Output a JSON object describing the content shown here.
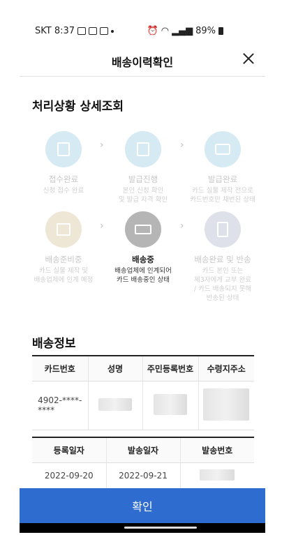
{
  "status_bar": {
    "carrier_time": "SKT 8:37",
    "battery": "89%"
  },
  "header": {
    "title": "배송이력확인"
  },
  "status_section": {
    "title": "처리상황 상세조회"
  },
  "steps": [
    {
      "label": "접수완료",
      "desc": "신청 접수 완료"
    },
    {
      "label": "발급진행",
      "desc": "본인 신청 확인\n및 발급 자격 확인"
    },
    {
      "label": "발급완료",
      "desc": "카드 실물 제작 전으로\n카드번호만 채번된 상태"
    },
    {
      "label": "배송준비중",
      "desc": "카드 실물 제작 및\n배송업체에 인계 예정"
    },
    {
      "label": "배송중",
      "desc": "배송업체에 인계되어\n카드 배송중인 상태"
    },
    {
      "label": "배송완료 및 반송",
      "desc": "카드 본인 또는\n제3자에게 교부 완료\n/ 카드 배송되지 못해\n반송된 상태"
    }
  ],
  "delivery_section": {
    "title": "배송정보"
  },
  "table1": {
    "headers": [
      "카드번호",
      "성명",
      "주민등록번호",
      "수령지주소"
    ],
    "card_number": "4902-****-\n****"
  },
  "table2": {
    "headers": [
      "등록일자",
      "발송일자",
      "발송번호"
    ],
    "registered_date": "2022-09-20",
    "sent_date": "2022-09-21"
  },
  "confirm_button": {
    "label": "확인"
  },
  "colors": {
    "primary": "#2f6ccf",
    "step_active": "#b5b5b5"
  }
}
